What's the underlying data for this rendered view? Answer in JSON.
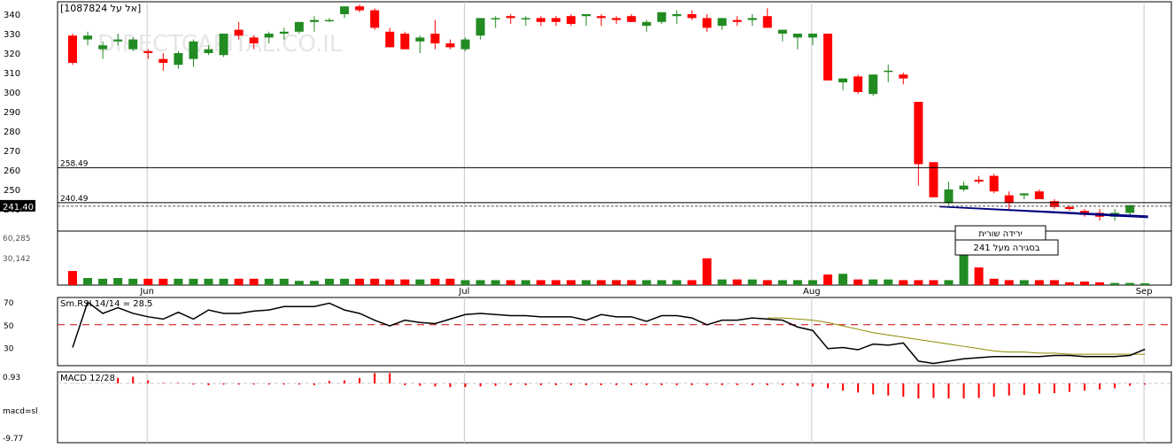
{
  "chart_data": {
    "type": "candlestick",
    "symbol_label": "[1087824 אל על]",
    "watermark": "DIRECTCAPITAL.CO.IL",
    "price_axis": {
      "ticks": [
        340,
        330,
        320,
        310,
        300,
        290,
        280,
        270,
        260,
        250,
        240
      ],
      "ylim": [
        237,
        342
      ],
      "last_price": "241.40",
      "last_price_value": 241.4
    },
    "month_labels": [
      {
        "label": "Jun",
        "index": 3
      },
      {
        "label": "Jul",
        "index": 24
      },
      {
        "label": "Aug",
        "index": 47
      },
      {
        "label": "Sep",
        "index": 69
      }
    ],
    "candles": [
      [
        329,
        330,
        314,
        315
      ],
      [
        327,
        331,
        324,
        329
      ],
      [
        322,
        326,
        317,
        324
      ],
      [
        326,
        330,
        324,
        327
      ],
      [
        322,
        328,
        321,
        327
      ],
      [
        321,
        322,
        317,
        320
      ],
      [
        317,
        320,
        311,
        315
      ],
      [
        314,
        321,
        312,
        320
      ],
      [
        317,
        327,
        313,
        326
      ],
      [
        320,
        324,
        319,
        322
      ],
      [
        319,
        330,
        318,
        330
      ],
      [
        332,
        336,
        327,
        329
      ],
      [
        328,
        329,
        322,
        325
      ],
      [
        328,
        331,
        325,
        330
      ],
      [
        330,
        333,
        327,
        331
      ],
      [
        331,
        336,
        330,
        336
      ],
      [
        336,
        339,
        331,
        337
      ],
      [
        337,
        338,
        336,
        337
      ],
      [
        340,
        344,
        338,
        344
      ],
      [
        344,
        345,
        341,
        342
      ],
      [
        342,
        343,
        332,
        333
      ],
      [
        331,
        333,
        323,
        323
      ],
      [
        330,
        331,
        322,
        322
      ],
      [
        326,
        329,
        320,
        328
      ],
      [
        330,
        337,
        322,
        325
      ],
      [
        325,
        327,
        322,
        323
      ],
      [
        322,
        328,
        321,
        327
      ],
      [
        329,
        337,
        327,
        338
      ],
      [
        338,
        339,
        333,
        338
      ],
      [
        339,
        340,
        335,
        338
      ],
      [
        338,
        339,
        334,
        338
      ],
      [
        338,
        339,
        334,
        336
      ],
      [
        338,
        339,
        334,
        336
      ],
      [
        339,
        340,
        334,
        335
      ],
      [
        339,
        340,
        334,
        340
      ],
      [
        339,
        340,
        334,
        338
      ],
      [
        338,
        339,
        335,
        337
      ],
      [
        339,
        340,
        336,
        336
      ],
      [
        334,
        337,
        331,
        336
      ],
      [
        336,
        341,
        335,
        341
      ],
      [
        339,
        342,
        335,
        340
      ],
      [
        340,
        342,
        337,
        338
      ],
      [
        338,
        340,
        331,
        333
      ],
      [
        334,
        338,
        332,
        338
      ],
      [
        337,
        339,
        334,
        336
      ],
      [
        337,
        340,
        334,
        338
      ],
      [
        339,
        343,
        333,
        333
      ],
      [
        330,
        332,
        326,
        332
      ],
      [
        328,
        330,
        322,
        330
      ],
      [
        328,
        329,
        324,
        330
      ],
      [
        330,
        330,
        306,
        306
      ],
      [
        305,
        306,
        301,
        307
      ],
      [
        308,
        309,
        299,
        300
      ],
      [
        299,
        309,
        298,
        309
      ],
      [
        311,
        314,
        305,
        311
      ],
      [
        309,
        310,
        304,
        307
      ],
      [
        295,
        295,
        252,
        263
      ],
      [
        264,
        264,
        246,
        246
      ],
      [
        243,
        254,
        242,
        250
      ],
      [
        250,
        254,
        249,
        252
      ],
      [
        255,
        257,
        253,
        254
      ],
      [
        257,
        258,
        248,
        249
      ],
      [
        247,
        249,
        240,
        243
      ],
      [
        247,
        248,
        245,
        248
      ],
      [
        249,
        250,
        245,
        245
      ],
      [
        244,
        245,
        240,
        241
      ],
      [
        241,
        242,
        239,
        240
      ],
      [
        239,
        240,
        236,
        237
      ],
      [
        238,
        240,
        234,
        236
      ],
      [
        236,
        240,
        234,
        238
      ],
      [
        238,
        242,
        237,
        242
      ]
    ],
    "levels": [
      {
        "label": "258.49",
        "value": 258.49
      },
      {
        "label": "240.49",
        "value": 240.49
      }
    ],
    "trend_lines": [
      {
        "from_index": 57.4,
        "from_value": 241.2,
        "to_index": 71.2,
        "to_value": 235.6
      },
      {
        "from_index": 57.4,
        "from_value": 241.2,
        "to_index": 71.2,
        "to_value": 236.3
      }
    ],
    "annotations": [
      "ירידה שורית",
      "בסגירה מעל 241"
    ],
    "volume_panel": {
      "labels": [
        "60,285",
        "30,142"
      ],
      "max": 90428,
      "bars": [
        20000,
        10000,
        9000,
        10000,
        9000,
        9000,
        9000,
        9000,
        9000,
        9000,
        9000,
        9000,
        9000,
        9000,
        9000,
        6000,
        6000,
        9000,
        9000,
        9000,
        9000,
        8000,
        8000,
        8000,
        9000,
        9000,
        7000,
        7000,
        7000,
        7000,
        7000,
        7000,
        7000,
        7000,
        7000,
        7000,
        7000,
        7000,
        7000,
        7000,
        7000,
        7000,
        38000,
        8000,
        8000,
        8000,
        7000,
        7000,
        7000,
        7000,
        15000,
        16000,
        8000,
        8000,
        8000,
        7000,
        7000,
        7000,
        7000,
        62000,
        25000,
        9000,
        7000,
        7000,
        7000,
        7000,
        4000,
        5000,
        4000,
        3000,
        3000,
        2000
      ]
    },
    "rsi_panel": {
      "title": "Sm.RSI 14/14 = 28.5",
      "ticks": [
        70,
        50,
        30
      ],
      "ylim": [
        14,
        74
      ],
      "threshold": 50,
      "rsi": [
        30,
        70,
        60,
        65,
        60,
        57,
        55,
        61,
        55,
        63,
        60,
        60,
        62,
        63,
        66,
        66,
        66,
        69,
        63,
        60,
        54,
        49,
        54,
        52,
        51,
        55,
        59,
        60,
        59,
        58,
        58,
        57,
        57,
        57,
        54,
        59,
        57,
        57,
        53,
        58,
        58,
        56,
        50,
        54,
        54,
        56,
        55,
        54,
        48,
        45,
        29,
        30,
        28,
        33,
        32,
        34,
        18,
        16,
        18,
        20,
        21,
        22,
        22,
        22,
        22,
        23,
        23,
        22,
        22,
        22,
        23,
        28.5
      ],
      "signal": [
        null,
        null,
        null,
        null,
        null,
        null,
        null,
        null,
        null,
        null,
        null,
        null,
        null,
        null,
        null,
        null,
        null,
        null,
        null,
        null,
        null,
        null,
        null,
        null,
        null,
        null,
        null,
        null,
        null,
        null,
        null,
        null,
        null,
        null,
        null,
        null,
        null,
        null,
        null,
        null,
        null,
        null,
        null,
        null,
        null,
        null,
        56,
        56,
        55,
        54,
        52,
        49,
        46,
        43,
        41,
        39,
        37,
        35,
        33,
        31,
        29,
        27,
        26,
        26,
        25,
        25,
        24,
        24,
        24,
        24,
        24,
        24
      ]
    },
    "macd_panel": {
      "title": "MACD 12/28",
      "labels": [
        "0.93",
        "macd=sl",
        "-9.77"
      ],
      "ylim": [
        -9.77,
        1.9
      ],
      "bars": [
        0,
        0,
        0,
        0.9,
        1.1,
        0.5,
        0.1,
        0.1,
        -0.2,
        -0.3,
        -0.2,
        -0.2,
        -0.2,
        -0.2,
        -0.2,
        -0.2,
        -0.3,
        0.4,
        0.5,
        0.9,
        1.7,
        1.7,
        -0.3,
        -0.4,
        -0.5,
        -0.6,
        -0.6,
        -0.5,
        -0.4,
        -0.3,
        -0.3,
        -0.3,
        -0.3,
        -0.3,
        -0.3,
        -0.3,
        -0.3,
        -0.3,
        -0.3,
        -0.3,
        -0.3,
        -0.3,
        -0.3,
        -0.3,
        -0.3,
        -0.3,
        -0.3,
        -0.3,
        -0.4,
        -0.5,
        -0.8,
        -1.2,
        -1.5,
        -1.8,
        -2.0,
        -2.2,
        -2.5,
        -2.4,
        -2.5,
        -2.5,
        -2.4,
        -2.2,
        -2.0,
        -1.9,
        -1.7,
        -1.6,
        -1.4,
        -1.2,
        -1.0,
        -0.8,
        -0.4,
        -0.2
      ]
    },
    "colors": {
      "up": "#228b22",
      "down": "#ff0000",
      "trendline": "#000080",
      "signal_line": "#8b8b00",
      "rsi_line": "#000000",
      "threshold_line": "#cc0000"
    }
  }
}
